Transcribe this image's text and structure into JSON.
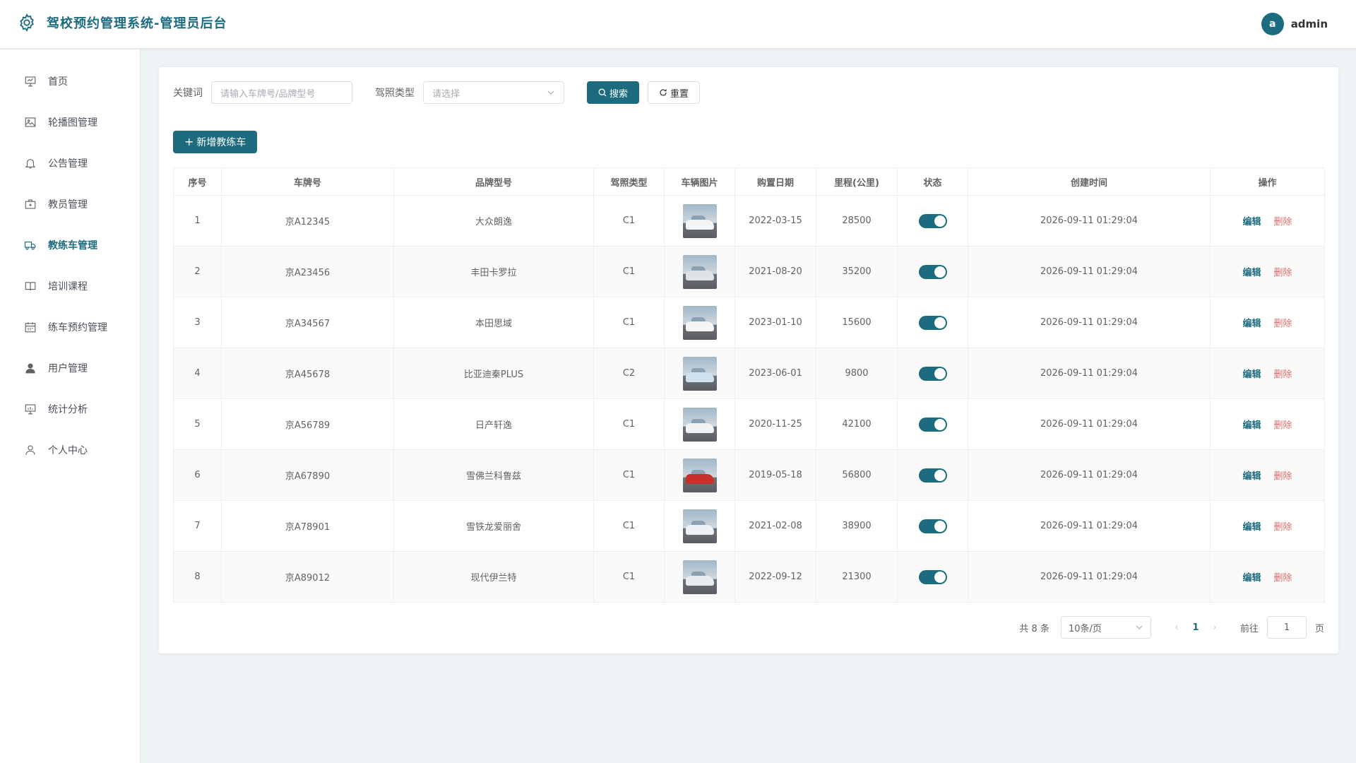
{
  "header": {
    "title": "驾校预约管理系统-管理员后台",
    "avatar_letter": "a",
    "user_name": "admin"
  },
  "sidebar": {
    "items": [
      {
        "label": "首页",
        "icon": "presentation-icon"
      },
      {
        "label": "轮播图管理",
        "icon": "image-icon"
      },
      {
        "label": "公告管理",
        "icon": "bell-icon"
      },
      {
        "label": "教员管理",
        "icon": "briefcase-icon"
      },
      {
        "label": "教练车管理",
        "icon": "truck-icon",
        "active": true
      },
      {
        "label": "培训课程",
        "icon": "book-icon"
      },
      {
        "label": "练车预约管理",
        "icon": "calendar-icon"
      },
      {
        "label": "用户管理",
        "icon": "user-filled-icon"
      },
      {
        "label": "统计分析",
        "icon": "chart-board-icon"
      },
      {
        "label": "个人中心",
        "icon": "user-icon"
      }
    ]
  },
  "filter": {
    "keyword_label": "关键词",
    "keyword_placeholder": "请输入车牌号/品牌型号",
    "license_label": "驾照类型",
    "license_placeholder": "请选择",
    "search_label": "搜索",
    "reset_label": "重置"
  },
  "add_button_label": "新增教练车",
  "table": {
    "columns": [
      "序号",
      "车牌号",
      "品牌型号",
      "驾照类型",
      "车辆图片",
      "购置日期",
      "里程(公里)",
      "状态",
      "创建时间",
      "操作"
    ],
    "rows": [
      {
        "index": "1",
        "plate": "京A12345",
        "model": "大众朗逸",
        "license": "C1",
        "date": "2022-03-15",
        "mileage": "28500",
        "status": true,
        "created": "2026-09-11 01:29:04",
        "car_color": "#f2f4f5"
      },
      {
        "index": "2",
        "plate": "京A23456",
        "model": "丰田卡罗拉",
        "license": "C1",
        "date": "2021-08-20",
        "mileage": "35200",
        "status": true,
        "created": "2026-09-11 01:29:04",
        "car_color": "#dfe3e6"
      },
      {
        "index": "3",
        "plate": "京A34567",
        "model": "本田思域",
        "license": "C1",
        "date": "2023-01-10",
        "mileage": "15600",
        "status": true,
        "created": "2026-09-11 01:29:04",
        "car_color": "#f5f5f5"
      },
      {
        "index": "4",
        "plate": "京A45678",
        "model": "比亚迪秦PLUS",
        "license": "C2",
        "date": "2023-06-01",
        "mileage": "9800",
        "status": true,
        "created": "2026-09-11 01:29:04",
        "car_color": "#cfe0ee"
      },
      {
        "index": "5",
        "plate": "京A56789",
        "model": "日产轩逸",
        "license": "C1",
        "date": "2020-11-25",
        "mileage": "42100",
        "status": true,
        "created": "2026-09-11 01:29:04",
        "car_color": "#f0f2f3"
      },
      {
        "index": "6",
        "plate": "京A67890",
        "model": "雪佛兰科鲁兹",
        "license": "C1",
        "date": "2019-05-18",
        "mileage": "56800",
        "status": true,
        "created": "2026-09-11 01:29:04",
        "car_color": "#c9302c"
      },
      {
        "index": "7",
        "plate": "京A78901",
        "model": "雪铁龙爱丽舍",
        "license": "C1",
        "date": "2021-02-08",
        "mileage": "38900",
        "status": true,
        "created": "2026-09-11 01:29:04",
        "car_color": "#eef1f3"
      },
      {
        "index": "8",
        "plate": "京A89012",
        "model": "现代伊兰特",
        "license": "C1",
        "date": "2022-09-12",
        "mileage": "21300",
        "status": true,
        "created": "2026-09-11 01:29:04",
        "car_color": "#e9ecee"
      }
    ],
    "edit_label": "编辑",
    "delete_label": "删除"
  },
  "pagination": {
    "total_text": "共 8 条",
    "page_size": "10条/页",
    "current_page": "1",
    "goto_label": "前往",
    "goto_value": "1",
    "page_suffix": "页"
  }
}
